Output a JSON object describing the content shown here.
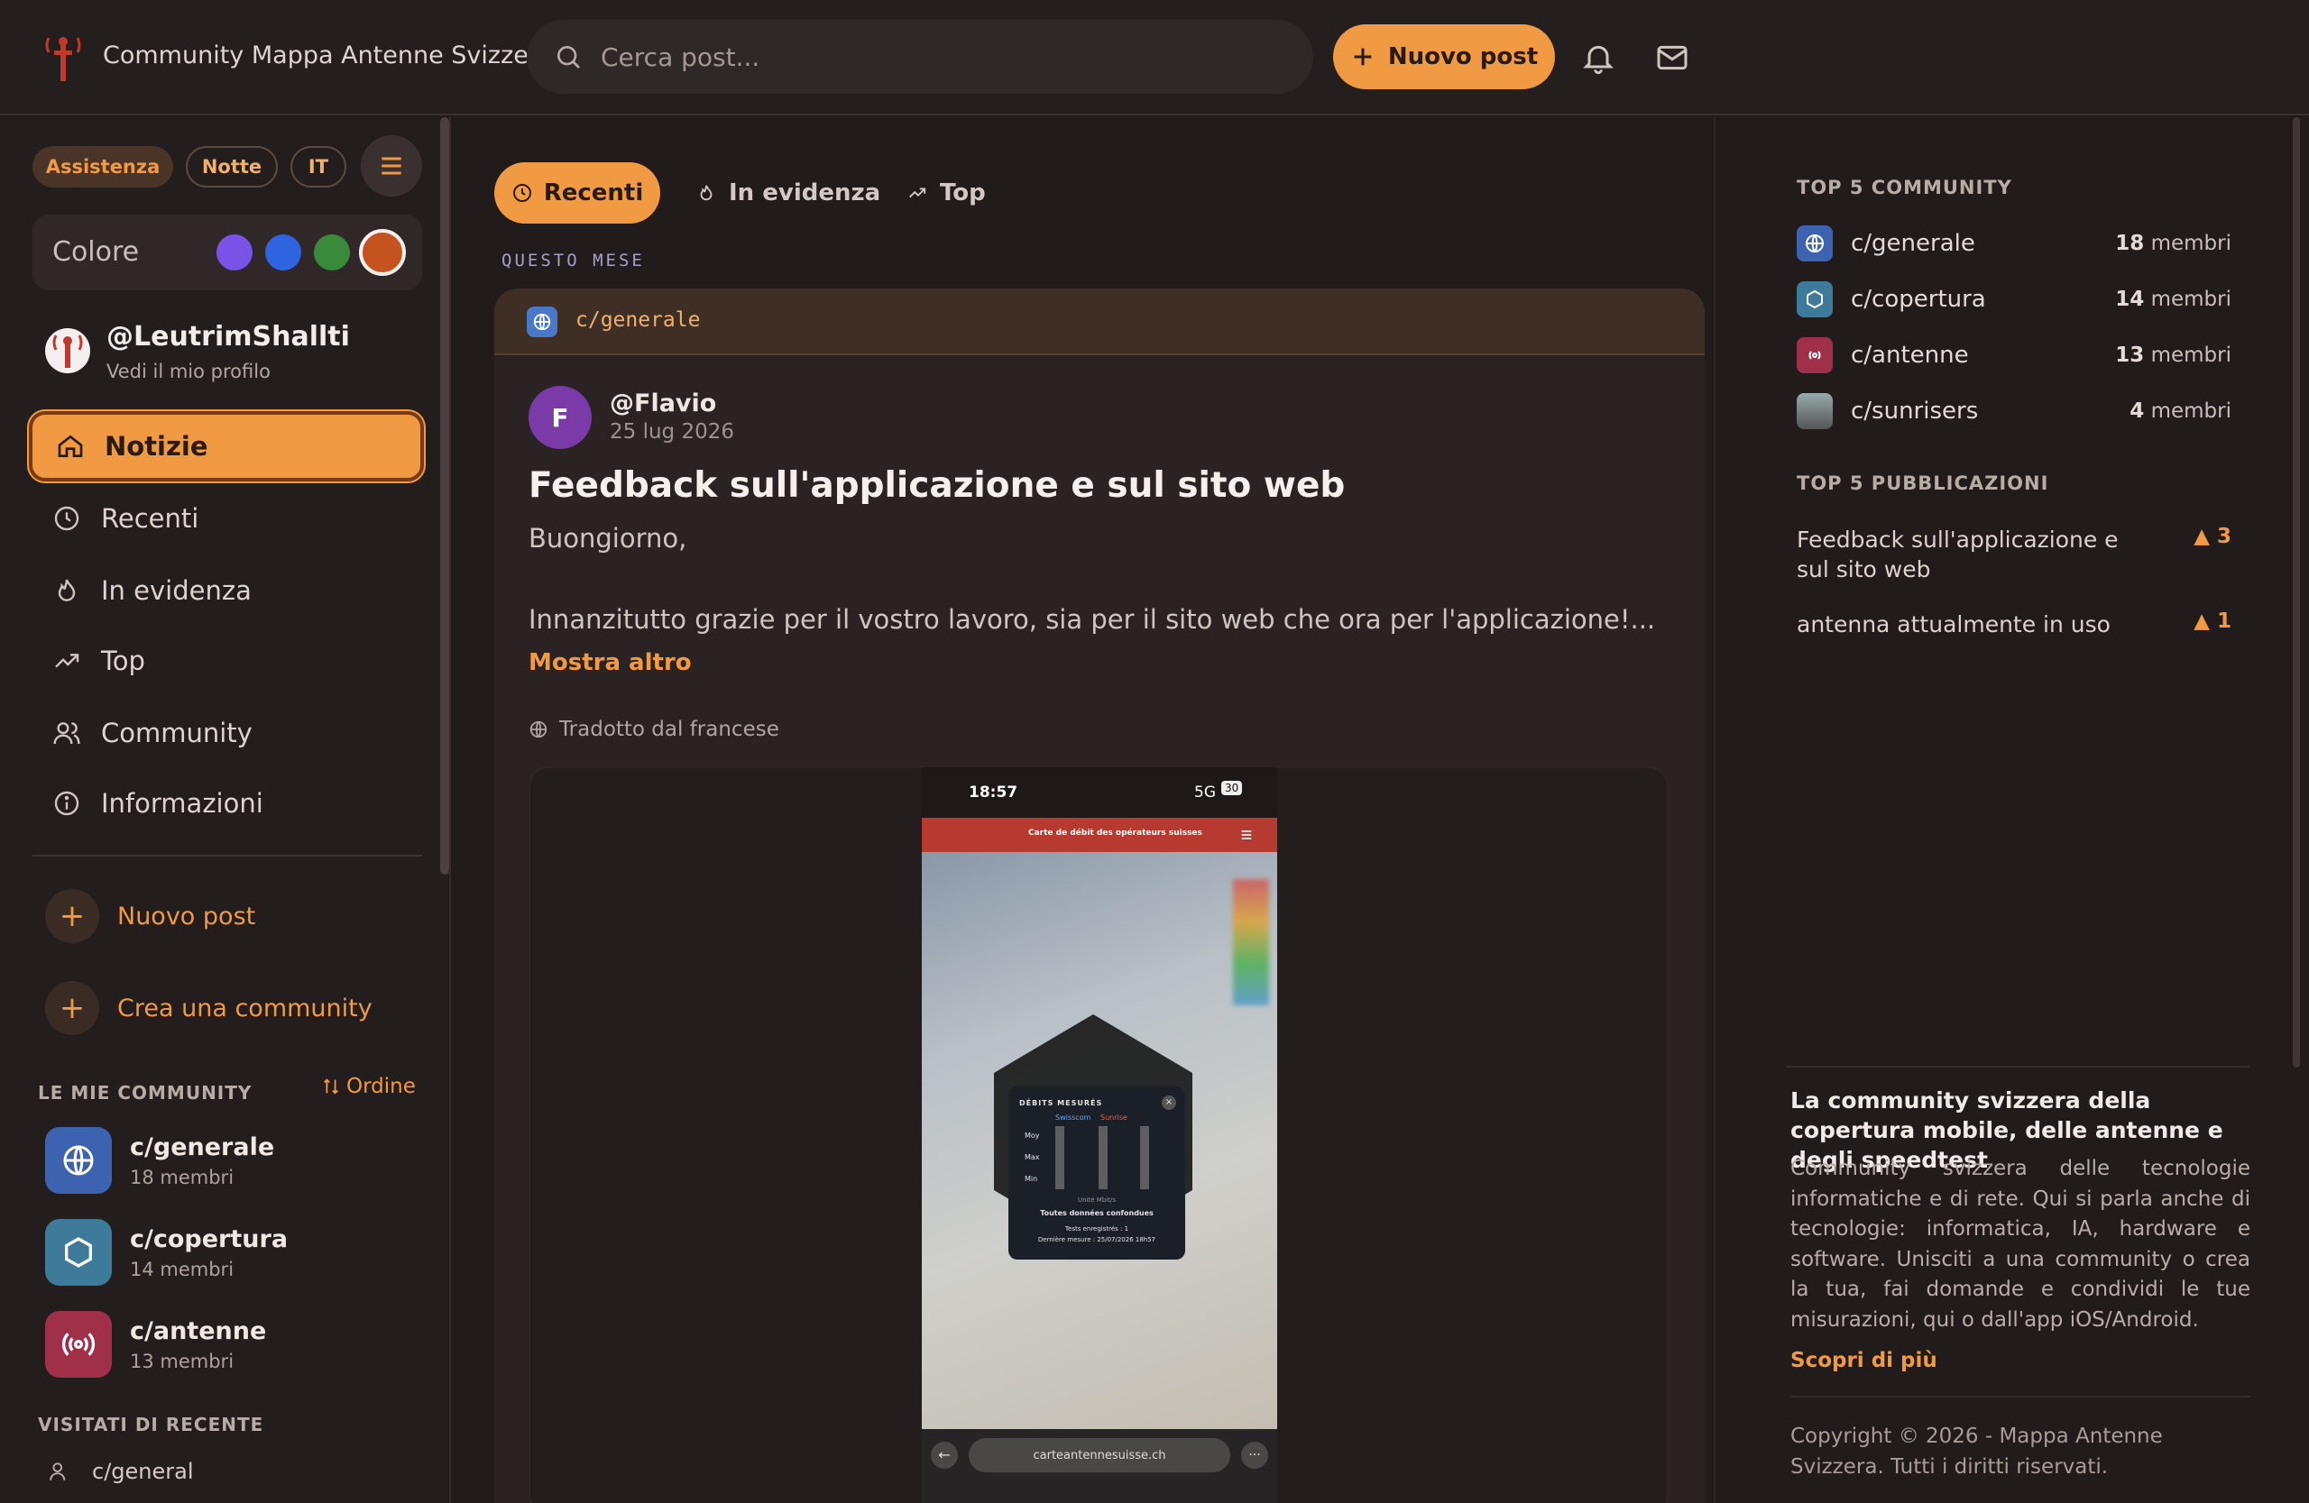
{
  "header": {
    "app_title": "Community Mappa Antenne Svizzera",
    "search_placeholder": "Cerca post...",
    "new_post_label": "Nuovo post"
  },
  "sidebar": {
    "pills": {
      "assist": "Assistenza",
      "night": "Notte",
      "lang": "IT"
    },
    "color_label": "Colore",
    "swatches": [
      "#7a52e8",
      "#2f64e0",
      "#3a8a3c",
      "#c4531f"
    ],
    "profile": {
      "name": "@LeutrimShallti",
      "sub": "Vedi il mio profilo"
    },
    "nav": [
      {
        "label": "Notizie",
        "icon": "home-icon"
      },
      {
        "label": "Recenti",
        "icon": "clock-icon"
      },
      {
        "label": "In evidenza",
        "icon": "flame-icon"
      },
      {
        "label": "Top",
        "icon": "trending-icon"
      },
      {
        "label": "Community",
        "icon": "users-icon"
      },
      {
        "label": "Informazioni",
        "icon": "info-icon"
      }
    ],
    "actions": {
      "new_post": "Nuovo post",
      "create_community": "Crea una community"
    },
    "my_communities_title": "LE MIE COMMUNITY",
    "order_label": "Ordine",
    "my_communities": [
      {
        "name": "c/generale",
        "members": "18 membri",
        "color": "#3d62b0"
      },
      {
        "name": "c/copertura",
        "members": "14 membri",
        "color": "#3e7a9a"
      },
      {
        "name": "c/antenne",
        "members": "13 membri",
        "color": "#a0304a"
      }
    ],
    "recent_title": "VISITATI DI RECENTE",
    "recent": [
      {
        "name": "c/general"
      }
    ]
  },
  "main": {
    "tabs": [
      {
        "label": "Recenti",
        "icon": "clock-icon"
      },
      {
        "label": "In evidenza",
        "icon": "flame-icon"
      },
      {
        "label": "Top",
        "icon": "trending-icon"
      }
    ],
    "month_label": "QUESTO MESE",
    "post": {
      "community": "c/generale",
      "author_initial": "F",
      "author": "@Flavio",
      "date": "25 lug 2026",
      "title": "Feedback sull'applicazione e sul sito web",
      "greeting": "Buongiorno,",
      "excerpt": "Innanzitutto grazie per il vostro lavoro, sia per il sito web che ora per l'applicazione!...",
      "show_more": "Mostra altro",
      "translated": "Tradotto dal francese",
      "screenshot": {
        "time": "18:57",
        "network": "5G",
        "battery": "30",
        "bar_title": "Carte de débit des opérateurs suisses",
        "popup_title": "DÉBITS MESURÉS",
        "popup_cols": [
          "Swisscom",
          "Sunrise"
        ],
        "popup_rows": [
          "Moy",
          "Max",
          "Min"
        ],
        "popup_unit": "Unité Mbit/s",
        "popup_all": "Toutes données confondues",
        "popup_tests": "Tests enregistrés : 1",
        "popup_last": "Dernière mesure : 25/07/2026 18h57",
        "url": "carteantennesuisse.ch"
      }
    }
  },
  "right": {
    "top_communities_title": "TOP 5 COMMUNITY",
    "top_communities": [
      {
        "name": "c/generale",
        "count": "18",
        "unit": "membri",
        "color": "#3d62b0"
      },
      {
        "name": "c/copertura",
        "count": "14",
        "unit": "membri",
        "color": "#3e7a9a"
      },
      {
        "name": "c/antenne",
        "count": "13",
        "unit": "membri",
        "color": "#a0304a"
      },
      {
        "name": "c/sunrisers",
        "count": "4",
        "unit": "membri",
        "color": "#6a6a6a"
      }
    ],
    "top_posts_title": "TOP 5 PUBBLICAZIONI",
    "top_posts": [
      {
        "title": "Feedback sull'applicazione e sul sito web",
        "score": "▲ 3"
      },
      {
        "title": "antenna attualmente in uso",
        "score": "▲ 1"
      }
    ],
    "about_title": "La community svizzera della copertura mobile, delle antenne e degli speedtest",
    "about_body": "Community svizzera delle tecnologie informatiche e di rete. Qui si parla anche di tecnologie: informatica, IA, hardware e software. Unisciti a una community o crea la tua, fai domande e condividi le tue misurazioni, qui o dall'app iOS/Android.",
    "about_link": "Scopri di più",
    "copyright": "Copyright © 2026 - Mappa Antenne Svizzera. Tutti i diritti riservati."
  }
}
